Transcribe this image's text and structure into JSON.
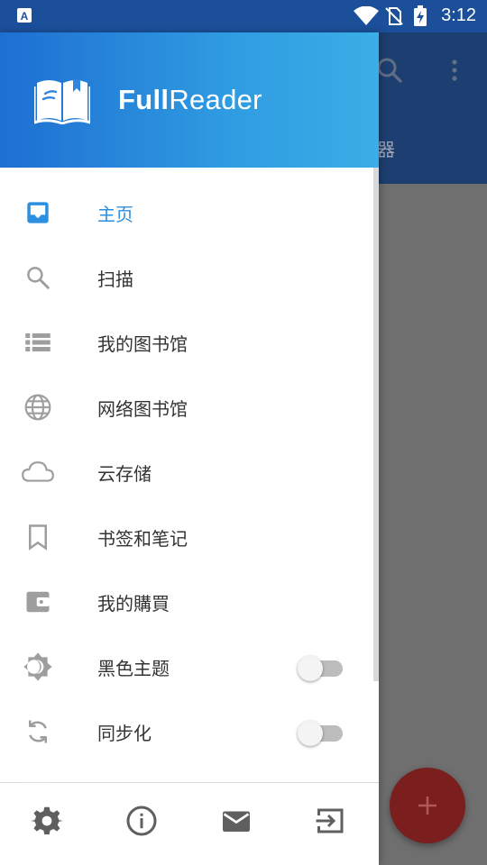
{
  "status_bar": {
    "time": "3:12",
    "notification_icon": "a-icon",
    "wifi_icon": "wifi-icon",
    "sim_icon": "no-sim-icon",
    "battery_icon": "battery-charging-icon"
  },
  "background": {
    "search_icon": "search-icon",
    "more_icon": "more-vert-icon",
    "tab_partial_label": "器",
    "fab_icon": "add-icon",
    "fab_color": "#7a1e1e"
  },
  "drawer": {
    "logo_icon": "book-icon",
    "title_bold": "Full",
    "title_regular": "Reader",
    "accent_color": "#2d8fe0",
    "header_gradient": [
      "#1e6fd2",
      "#3aaee6"
    ],
    "menu": [
      {
        "label": "主页",
        "icon": "inbox-icon",
        "active": true
      },
      {
        "label": "扫描",
        "icon": "search-icon",
        "active": false
      },
      {
        "label": "我的图书馆",
        "icon": "list-icon",
        "active": false
      },
      {
        "label": "网络图书馆",
        "icon": "globe-icon",
        "active": false
      },
      {
        "label": "云存储",
        "icon": "cloud-icon",
        "active": false
      },
      {
        "label": "书签和笔记",
        "icon": "bookmark-icon",
        "active": false
      },
      {
        "label": "我的購買",
        "icon": "wallet-icon",
        "active": false
      },
      {
        "label": "黑色主题",
        "icon": "brightness-icon",
        "active": false,
        "toggle": false
      },
      {
        "label": "同步化",
        "icon": "sync-icon",
        "active": false,
        "toggle": false
      }
    ],
    "bottom_bar": [
      {
        "icon": "settings-icon"
      },
      {
        "icon": "info-icon"
      },
      {
        "icon": "mail-icon"
      },
      {
        "icon": "exit-icon"
      }
    ]
  }
}
